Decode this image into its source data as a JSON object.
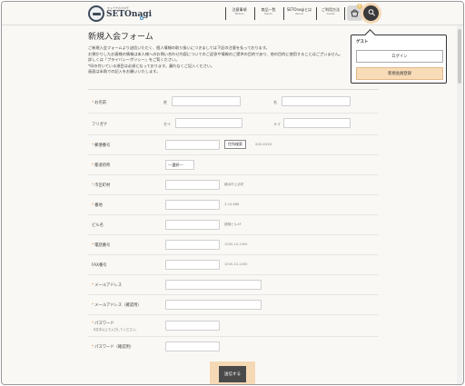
{
  "brand": {
    "sub": "セトウチのカタチ",
    "name": "SETOnagi"
  },
  "nav": [
    {
      "jp": "注意事項",
      "en": "Notice"
    },
    {
      "jp": "商品一覧",
      "en": "Items"
    },
    {
      "jp": "SETOnagiとは",
      "en": "About"
    },
    {
      "jp": "ご利用方法",
      "en": "Guide"
    }
  ],
  "cart": {
    "count": "0"
  },
  "page_title": "新規入会フォーム",
  "intro": [
    "ご新規入会フォームより送信いただく、個人情報の取り扱いにつきましては下記の注意を払っております。",
    "お預かりしたお客様の情報は本人様へのお問い合わせ内容についてのご返答や情報のご提供の目的であり、他の目的に使用することはございません。",
    "詳しくは「プライバシーポリシー」をご覧ください。",
    "*印の付いている項目は必須となっております。漏れなくご記入ください。",
    "画面は半角での記入をお願いいたします。"
  ],
  "form": {
    "name": {
      "label": "お名前",
      "sei": "姓",
      "mei": "名"
    },
    "kana": {
      "label": "フリガナ",
      "sei": "セイ",
      "mei": "メイ"
    },
    "zip": {
      "label": "郵便番号",
      "button": "住所検索",
      "hint": "XXX-XXXX"
    },
    "pref": {
      "label": "都道府県",
      "select": "---選択---"
    },
    "city": {
      "label": "市区町村",
      "hint": "横浜市上北町"
    },
    "address": {
      "label": "番地",
      "hint": "3-24-666"
    },
    "building": {
      "label": "ビル名",
      "hint": "建築ビル4F"
    },
    "tel": {
      "label": "電話番号",
      "hint": "1000-10-1000"
    },
    "fax": {
      "label": "FAX番号",
      "hint": "1000-10-1000"
    },
    "email": {
      "label": "メールアドレス"
    },
    "email_confirm": {
      "label": "メールアドレス（確認用）"
    },
    "password": {
      "label": "パスワード",
      "sub": "8文字以上で入力してください。"
    },
    "password_confirm": {
      "label": "パスワード（確認用）"
    },
    "required_mark": "*"
  },
  "submit_label": "送信する",
  "popup": {
    "guest": "ゲスト",
    "login": "ログイン",
    "register": "新規会員登録"
  }
}
